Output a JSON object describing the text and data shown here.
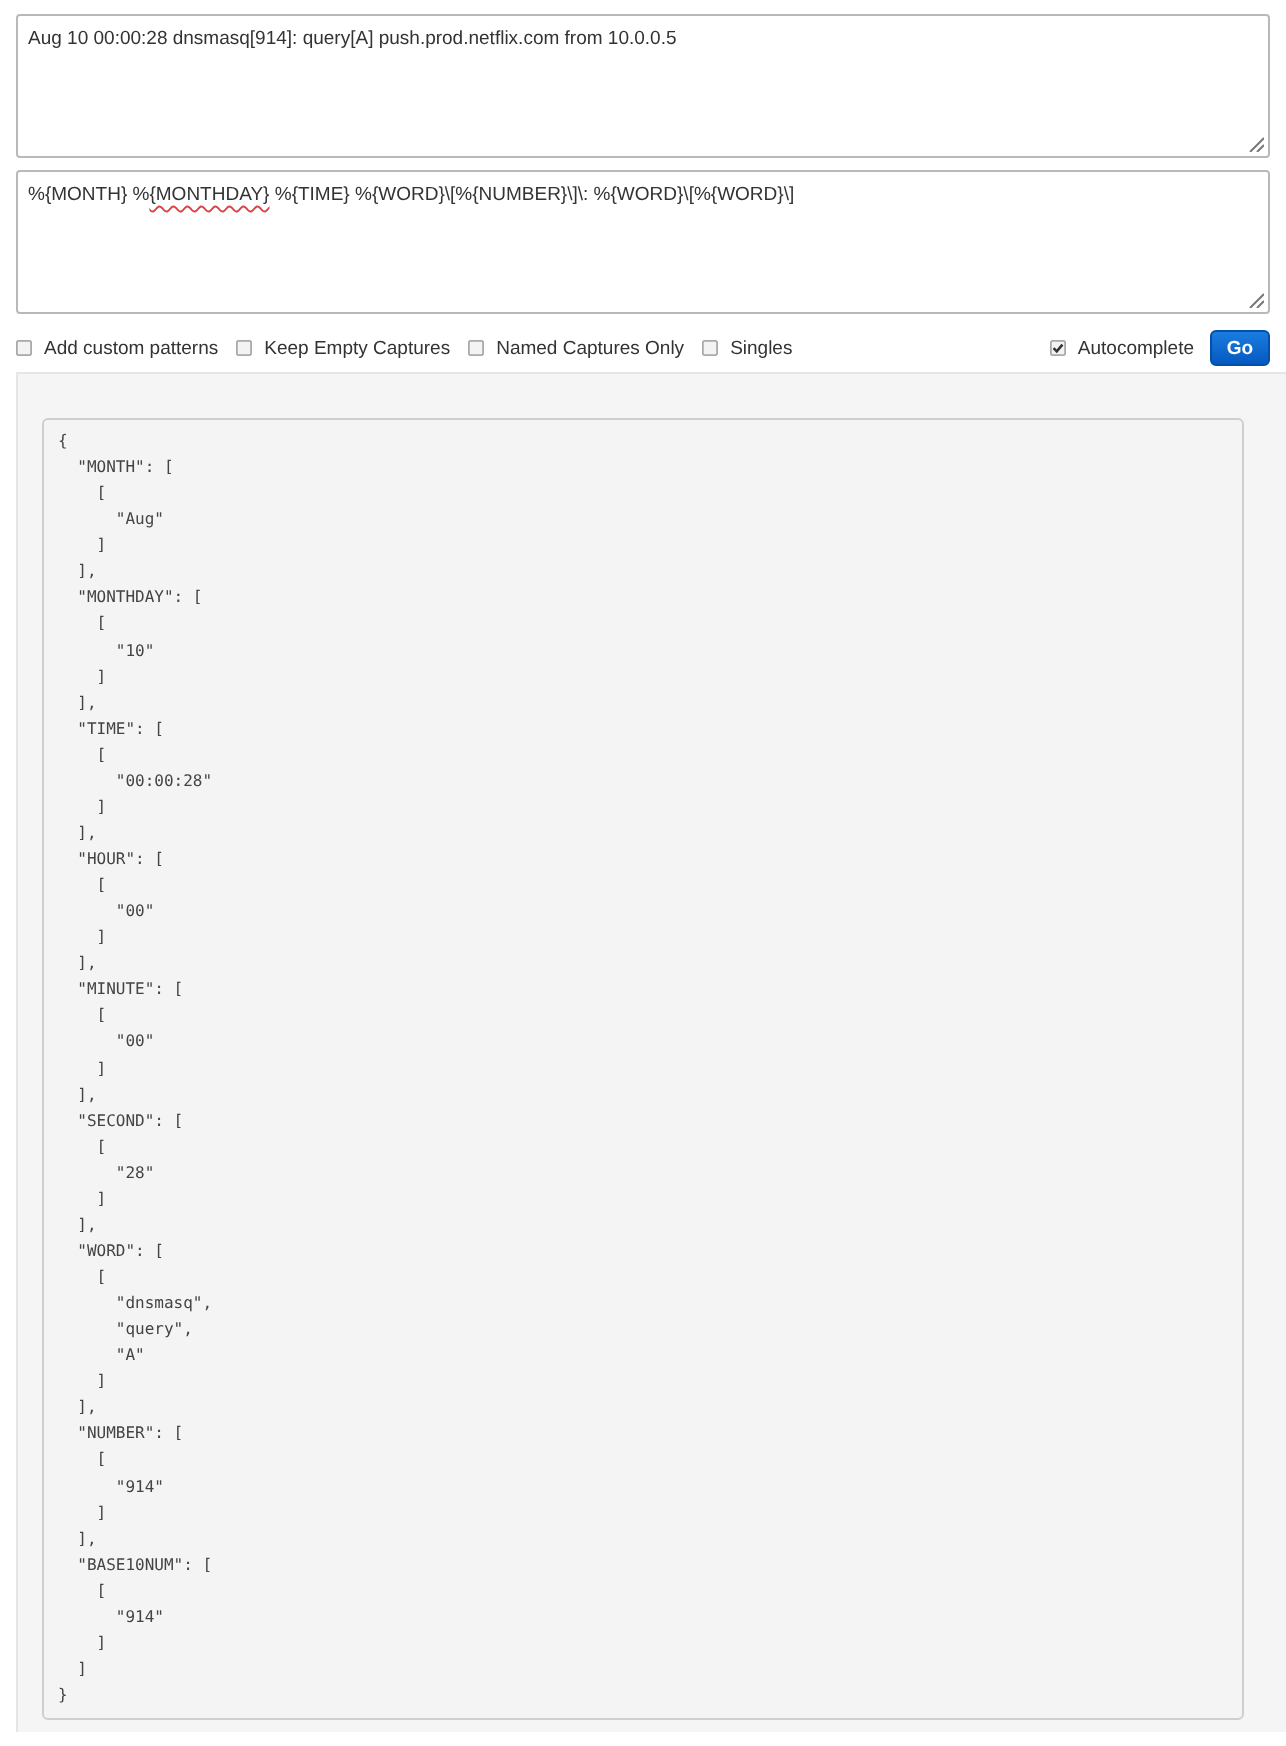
{
  "log_input": {
    "value": "Aug 10 00:00:28 dnsmasq[914]: query[A] push.prod.netflix.com from 10.0.0.5"
  },
  "pattern_input": {
    "segments": [
      {
        "text": "%{MONTH} %",
        "misspelled": false
      },
      {
        "text": "{MONTHDAY}",
        "misspelled": true
      },
      {
        "text": " %{TIME} %{WORD}\\[%{NUMBER}\\]\\: %{WORD}\\[%{WORD}\\]",
        "misspelled": false
      }
    ]
  },
  "options": [
    {
      "label": "Add custom patterns",
      "checked": false
    },
    {
      "label": "Keep Empty Captures",
      "checked": false
    },
    {
      "label": "Named Captures Only",
      "checked": false
    },
    {
      "label": "Singles",
      "checked": false
    }
  ],
  "autocomplete": {
    "label": "Autocomplete",
    "checked": true
  },
  "go_button": {
    "label": "Go"
  },
  "output": {
    "lines": [
      "{",
      "  \"MONTH\": [",
      "    [",
      "      \"Aug\"",
      "    ]",
      "  ],",
      "  \"MONTHDAY\": [",
      "    [",
      "      \"10\"",
      "    ]",
      "  ],",
      "  \"TIME\": [",
      "    [",
      "      \"00:00:28\"",
      "    ]",
      "  ],",
      "  \"HOUR\": [",
      "    [",
      "      \"00\"",
      "    ]",
      "  ],",
      "  \"MINUTE\": [",
      "    [",
      "      \"00\"",
      "    ]",
      "  ],",
      "  \"SECOND\": [",
      "    [",
      "      \"28\"",
      "    ]",
      "  ],",
      "  \"WORD\": [",
      "    [",
      "      \"dnsmasq\",",
      "      \"query\",",
      "      \"A\"",
      "    ]",
      "  ],",
      "  \"NUMBER\": [",
      "    [",
      "      \"914\"",
      "    ]",
      "  ],",
      "  \"BASE10NUM\": [",
      "    [",
      "      \"914\"",
      "    ]",
      "  ]",
      "}"
    ]
  }
}
